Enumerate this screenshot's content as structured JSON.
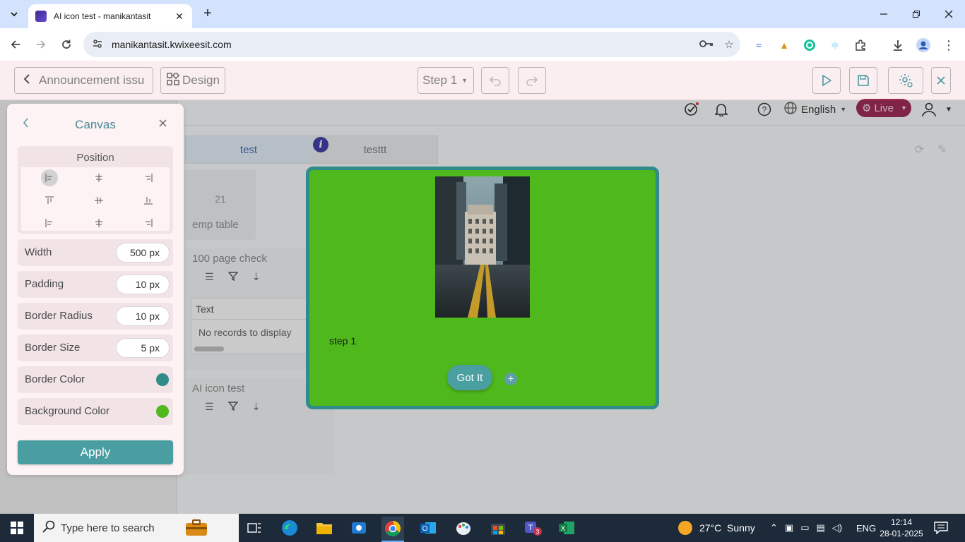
{
  "browser": {
    "tab_title": "AI icon test - manikantasit",
    "tab_close": "✕",
    "new_tab": "+",
    "url": "manikantasit.kwixeesit.com"
  },
  "editor_bar": {
    "back_label": "Announcement issu",
    "design_label": "Design",
    "step_select": "Step 1"
  },
  "app_header": {
    "language": "English",
    "live_label": "Live"
  },
  "workspace": {
    "tabs": [
      "test",
      "testtt"
    ],
    "info_badge": "i",
    "emp_card": {
      "number": "21",
      "label": "emp table"
    },
    "widget1_title": "100 page check",
    "grid_header": "Text",
    "grid_empty": "No records to display",
    "widget2_title": "AI icon test"
  },
  "popup": {
    "step_text": "step 1",
    "got_it_label": "Got It",
    "add_label": "+",
    "background_color": "#4fb81c",
    "border_color": "#2f8c8a"
  },
  "panel": {
    "title": "Canvas",
    "position_title": "Position",
    "width_label": "Width",
    "width_value": "500 px",
    "padding_label": "Padding",
    "padding_value": "10 px",
    "radius_label": "Border Radius",
    "radius_value": "10 px",
    "border_size_label": "Border Size",
    "border_size_value": "5 px",
    "border_color_label": "Border Color",
    "bg_color_label": "Background Color",
    "border_color": "#2f8c8a",
    "bg_color": "#4fb81c",
    "apply_label": "Apply"
  },
  "taskbar": {
    "search_placeholder": "Type here to search",
    "weather": "27°C  Sunny",
    "lang": "ENG",
    "time": "12:14",
    "date": "28-01-2025",
    "teams_badge": "3"
  }
}
